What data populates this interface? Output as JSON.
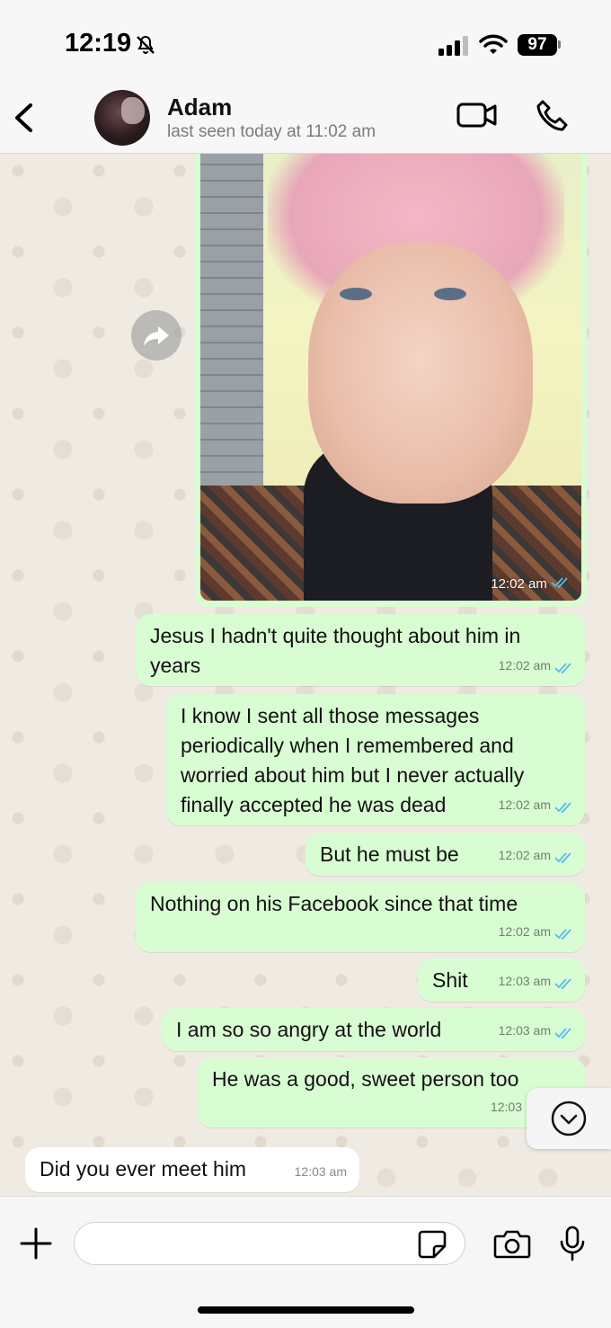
{
  "status_bar": {
    "time": "12:19",
    "battery": "97"
  },
  "header": {
    "contact_name": "Adam",
    "last_seen": "last seen today at 11:02 am"
  },
  "photo_message": {
    "time": "12:02 am"
  },
  "messages": [
    {
      "direction": "out",
      "text": "Jesus I hadn't quite thought about him in years",
      "time": "12:02 am"
    },
    {
      "direction": "out",
      "text": "I know I sent all those messages periodically when I remembered and worried about him but I never actually finally accepted he was dead",
      "time": "12:02 am"
    },
    {
      "direction": "out",
      "text": "But he must be",
      "time": "12:02 am"
    },
    {
      "direction": "out",
      "text": "Nothing on his Facebook since that time",
      "time": "12:02 am"
    },
    {
      "direction": "out",
      "text": "Shit",
      "time": "12:03 am"
    },
    {
      "direction": "out",
      "text": "I am so so angry at the world",
      "time": "12:03 am"
    },
    {
      "direction": "out",
      "text": "He was a good, sweet person too",
      "time": "12:03"
    },
    {
      "direction": "in",
      "text": "Did you ever meet him",
      "time": "12:03 am"
    }
  ],
  "colors": {
    "outgoing_bubble": "#d9fdd3",
    "incoming_bubble": "#ffffff",
    "read_ticks": "#53bdeb"
  }
}
